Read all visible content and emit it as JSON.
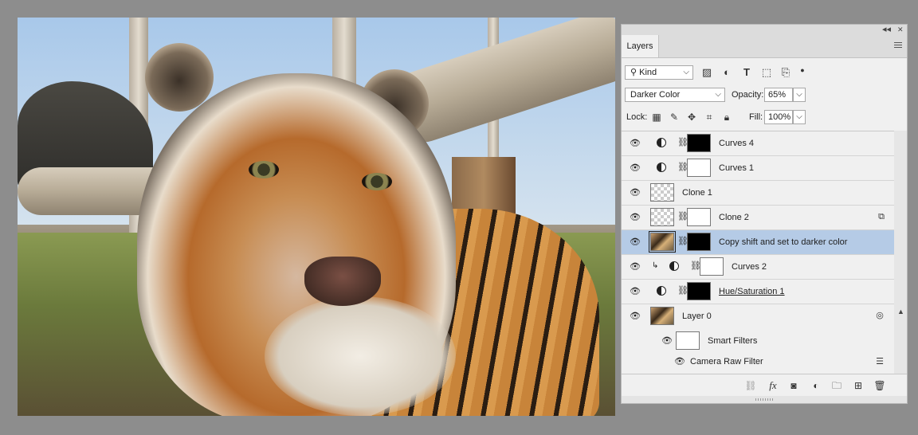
{
  "panel": {
    "collapse_icon": "◂◂",
    "close_icon": "✕",
    "tab_label": "Layers",
    "filter": {
      "kind_label": "Kind",
      "icons": [
        "image-filter-icon",
        "adjustment-filter-icon",
        "type-filter-icon",
        "shape-filter-icon",
        "smart-object-filter-icon"
      ]
    },
    "blend_mode": "Darker Color",
    "opacity_label": "Opacity:",
    "opacity_value": "65%",
    "lock_label": "Lock:",
    "fill_label": "Fill:",
    "fill_value": "100%",
    "layers": [
      {
        "name": "Curves 4",
        "type": "adjustment",
        "mask": "black",
        "linked": true
      },
      {
        "name": "Curves 1",
        "type": "adjustment",
        "mask": "white",
        "linked": true
      },
      {
        "name": "Clone 1",
        "type": "pixel",
        "thumb": "transparent"
      },
      {
        "name": "Clone 2",
        "type": "pixel",
        "thumb": "transparent",
        "mask": "white",
        "linked": true
      },
      {
        "name": "Copy shift and set to darker color",
        "type": "pixel",
        "thumb": "photo",
        "mask": "black",
        "linked": true,
        "selected": true
      },
      {
        "name": "Curves 2",
        "type": "adjustment",
        "mask": "white",
        "linked": true,
        "clipped": true
      },
      {
        "name": "Hue/Saturation 1",
        "type": "adjustment",
        "mask": "black",
        "linked": true
      },
      {
        "name": "Layer 0",
        "type": "smart-object",
        "thumb": "photo"
      }
    ],
    "smart_filters_label": "Smart Filters",
    "camera_raw_label": "Camera Raw Filter",
    "bottom_icons": [
      "link-layers-icon",
      "fx-icon",
      "add-mask-icon",
      "new-adjustment-icon",
      "new-group-icon",
      "new-layer-icon",
      "delete-icon"
    ],
    "fx_label": "fx"
  },
  "colors": {
    "selected_row": "#b5cbe6",
    "panel_bg": "#f0f0f0",
    "workspace_bg": "#8d8d8d"
  }
}
